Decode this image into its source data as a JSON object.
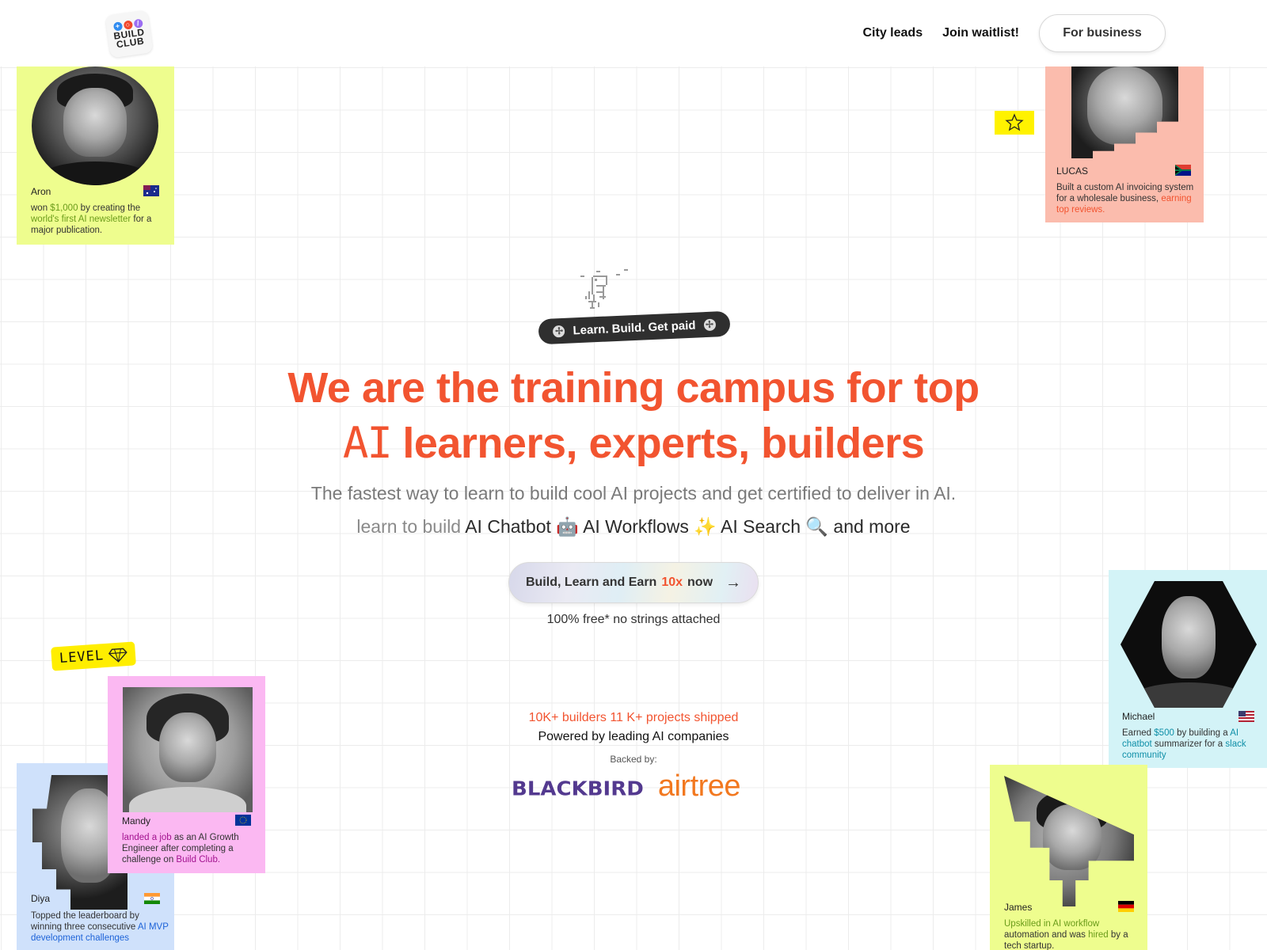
{
  "header": {
    "logo": {
      "line1": "BUILD",
      "line2": "CLUB",
      "dot_colors": [
        "#2f8bf0",
        "#f2472b",
        "#9b6df2"
      ]
    },
    "nav": [
      {
        "label": "City leads"
      },
      {
        "label": "Join waitlist!"
      }
    ],
    "business_button": "For business"
  },
  "hero": {
    "tagline": "Learn. Build. Get paid",
    "headline_line1": "We are the training campus for top",
    "headline_ai": "AI",
    "headline_line2_rest": " learners, experts, builders",
    "subline": "The fastest way to learn to build cool AI projects and get certified to deliver in AI.",
    "learn_prefix": "learn to build",
    "learn_items": [
      {
        "label": "AI Chatbot",
        "emoji": "🤖"
      },
      {
        "label": "AI Workflows",
        "emoji": "✨"
      },
      {
        "label": "AI Search",
        "emoji": "🔍"
      }
    ],
    "learn_suffix": "and more",
    "cta": {
      "prefix": "Build, Learn and Earn",
      "accent": "10x",
      "suffix": "now",
      "arrow": "→"
    },
    "free_note": "100% free* no strings attached",
    "stats": "10K+ builders 11 K+ projects shipped",
    "powered": "Powered by leading AI companies",
    "backed_label": "Backed by:",
    "backers": [
      "BLACKBIRD",
      "airtree"
    ]
  },
  "badges": {
    "star": "☆",
    "level": "LEVEL",
    "level_icon": "diamond"
  },
  "colors": {
    "brand_orange": "#f25430",
    "blackbird_purple": "#53398f",
    "airtree_orange": "#f2781f",
    "badge_yellow": "#ffee00"
  },
  "cards": [
    {
      "name": "Aron",
      "flag": "australia",
      "bg": "#eefd8e",
      "desc_parts": [
        {
          "text": "won ",
          "hl": false
        },
        {
          "text": "$1,000",
          "hl": true
        },
        {
          "text": " by creating the ",
          "hl": false
        },
        {
          "text": "world's first AI newsletter",
          "hl": true
        },
        {
          "text": " for a major publication.",
          "hl": false
        }
      ],
      "hl_color": "#6b9c1a"
    },
    {
      "name": "LUCAS",
      "flag": "south-africa",
      "bg": "#fbbcad",
      "desc_parts": [
        {
          "text": "Built a custom AI invoicing system for a wholesale business, ",
          "hl": false
        },
        {
          "text": "earning top reviews.",
          "hl": true
        }
      ],
      "hl_color": "#f25430"
    },
    {
      "name": "Mandy",
      "flag": "eu",
      "bg": "#fbb8f2",
      "desc_parts": [
        {
          "text": "landed a job",
          "hl": true
        },
        {
          "text": " as an AI Growth Engineer after completing a challenge on ",
          "hl": false
        },
        {
          "text": "Build Club.",
          "hl": true
        }
      ],
      "hl_color": "#a3138f"
    },
    {
      "name": "Diya",
      "flag": "india",
      "bg": "#cfe1fb",
      "desc_parts": [
        {
          "text": "Topped the leaderboard by winning three consecutive ",
          "hl": false
        },
        {
          "text": "AI MVP development challenges",
          "hl": true
        }
      ],
      "hl_color": "#1d63d8"
    },
    {
      "name": "Michael",
      "flag": "usa",
      "bg": "#d3f3f7",
      "desc_parts": [
        {
          "text": "Earned ",
          "hl": false
        },
        {
          "text": "$500",
          "hl": true
        },
        {
          "text": " by building a ",
          "hl": false
        },
        {
          "text": "AI chatbot",
          "hl": true
        },
        {
          "text": " summarizer for a ",
          "hl": false
        },
        {
          "text": "slack community",
          "hl": true
        }
      ],
      "hl_color": "#0f8fa8"
    },
    {
      "name": "James",
      "flag": "germany",
      "bg": "#eefd8e",
      "desc_parts": [
        {
          "text": "Upskilled in AI workflow",
          "hl": true
        },
        {
          "text": " automation and was ",
          "hl": false
        },
        {
          "text": "hired",
          "hl": true
        },
        {
          "text": " by a tech startup.",
          "hl": false
        }
      ],
      "hl_color": "#6b9c1a"
    }
  ]
}
